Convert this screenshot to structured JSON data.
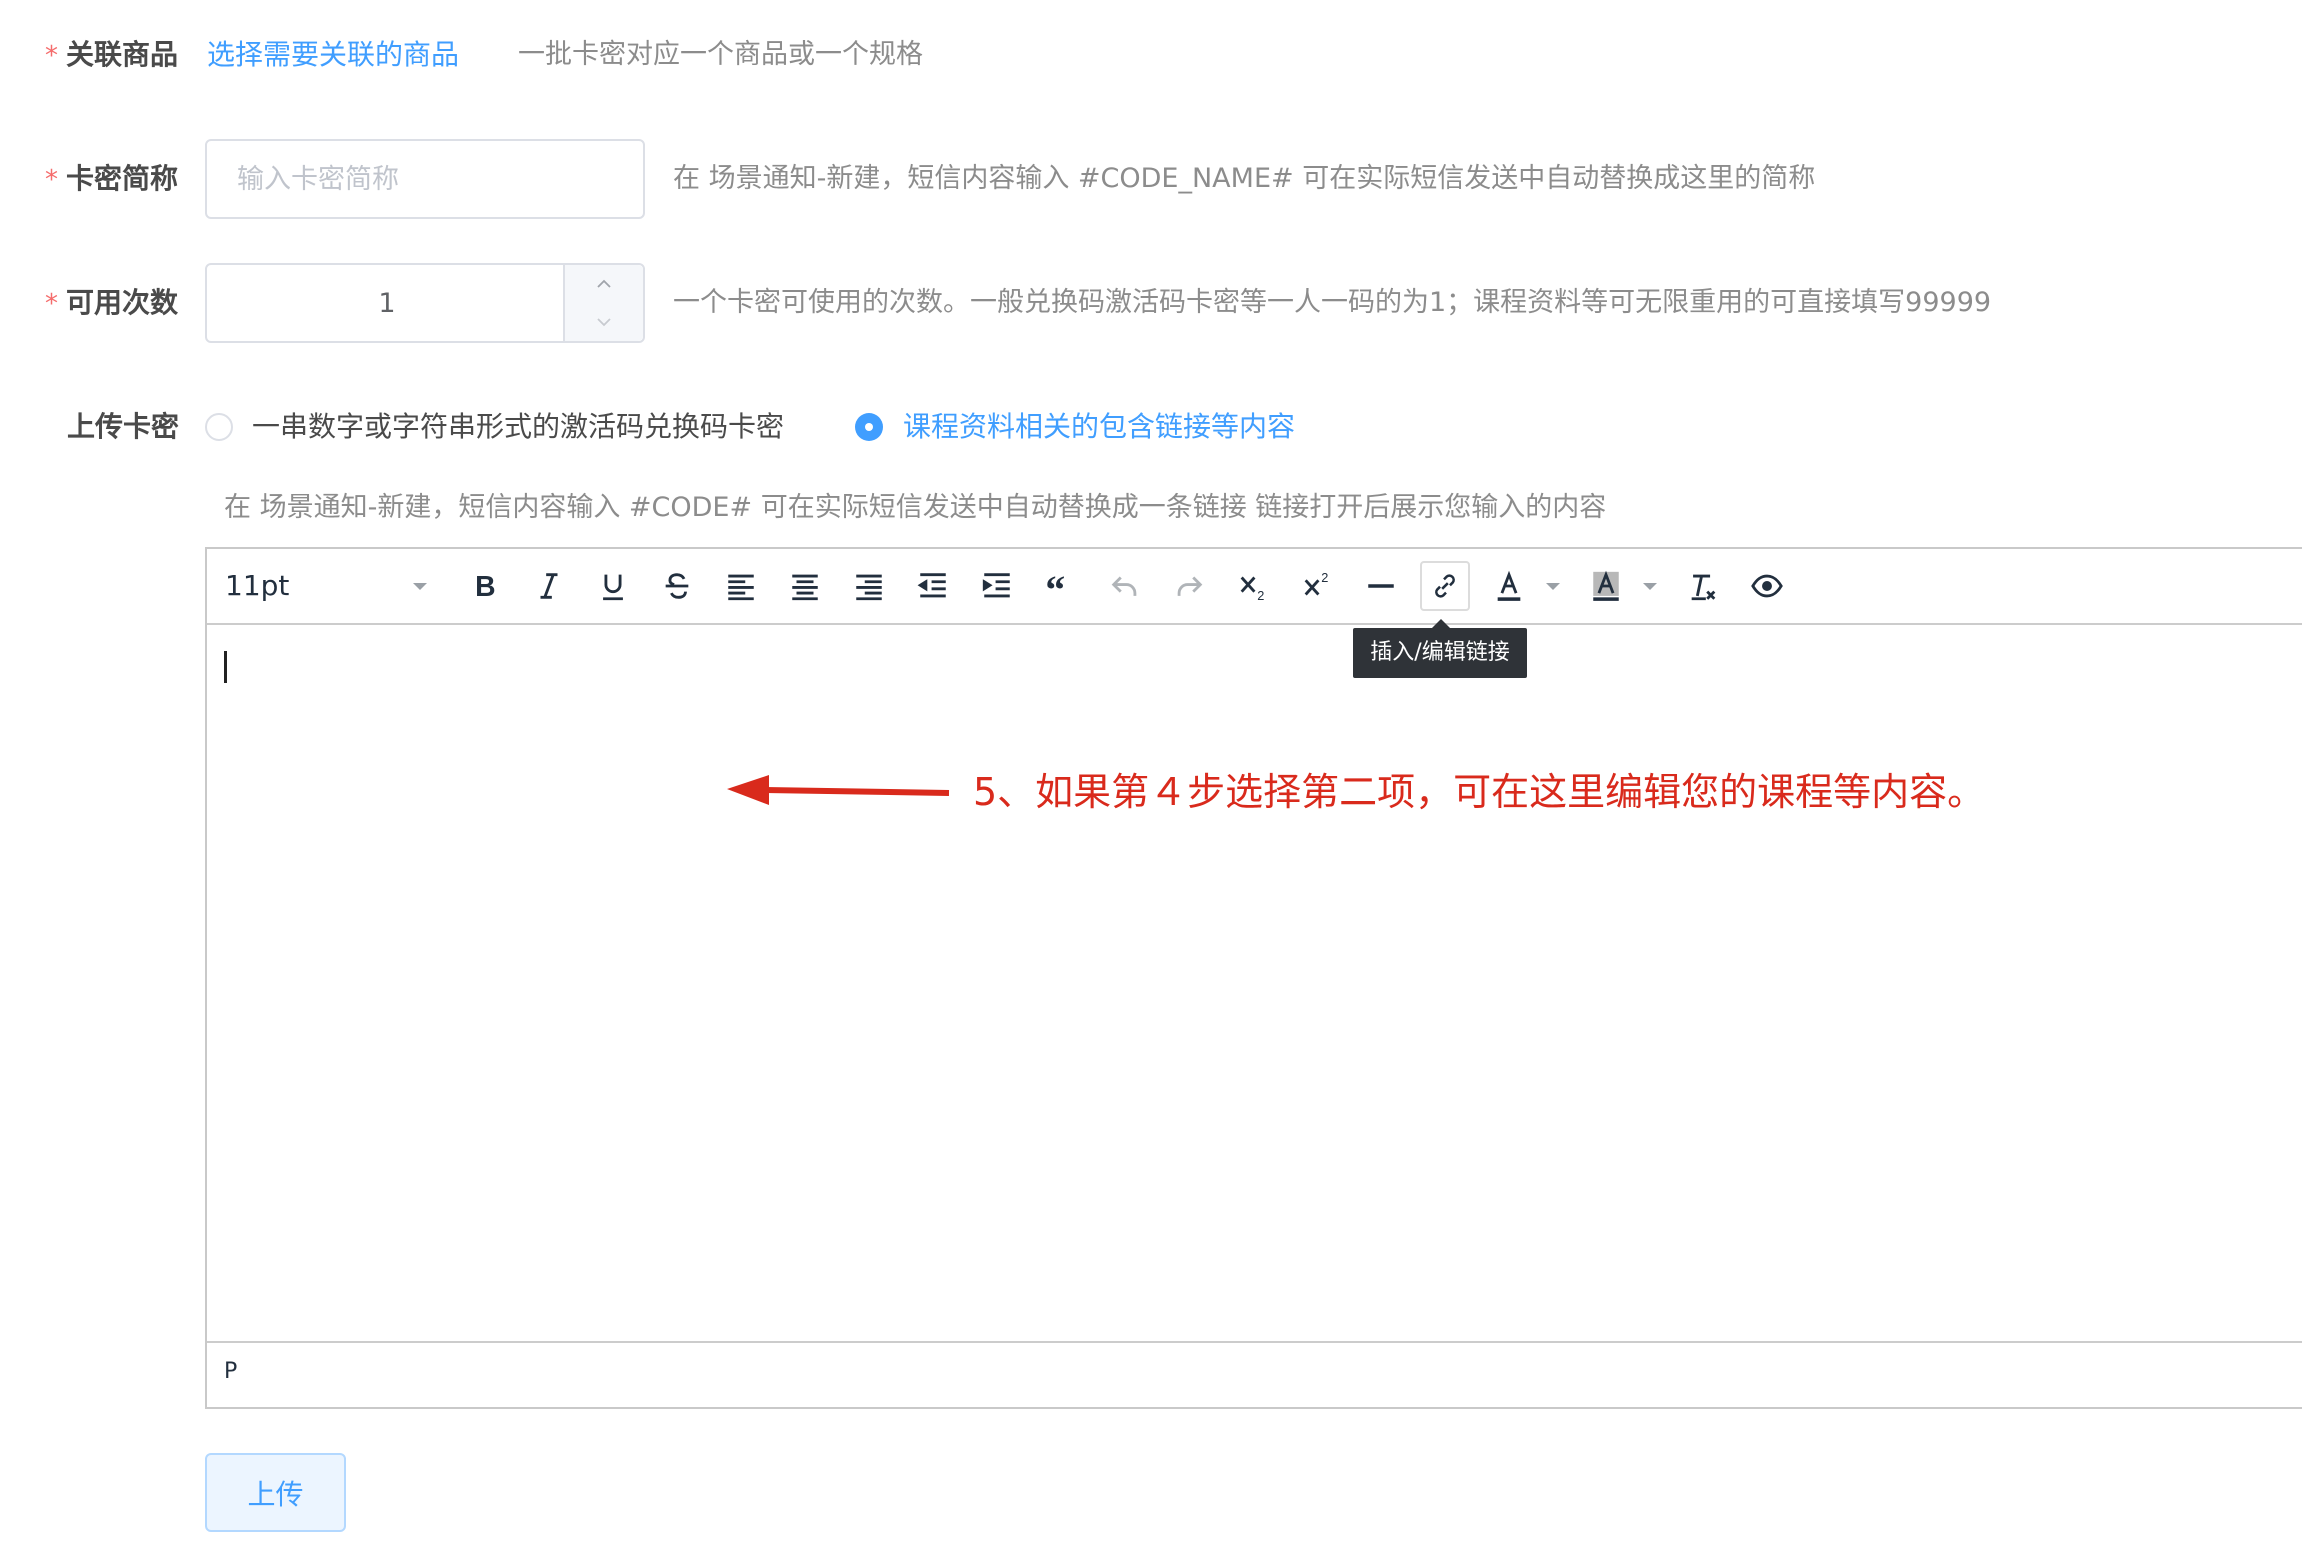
{
  "form": {
    "product": {
      "label": "关联商品",
      "select_link": "选择需要关联的商品",
      "hint": "一批卡密对应一个商品或一个规格"
    },
    "short_name": {
      "label": "卡密简称",
      "placeholder": "输入卡密简称",
      "hint": "在 场景通知-新建，短信内容输入 #CODE_NAME# 可在实际短信发送中自动替换成这里的简称"
    },
    "uses": {
      "label": "可用次数",
      "value": "1",
      "hint": "一个卡密可使用的次数。一般兑换码激活码卡密等一人一码的为1；课程资料等可无限重用的可直接填写99999"
    },
    "upload_type": {
      "label": "上传卡密",
      "options": [
        {
          "label": "一串数字或字符串形式的激活码兑换码卡密",
          "selected": false
        },
        {
          "label": "课程资料相关的包含链接等内容",
          "selected": true
        }
      ],
      "hint": "在 场景通知-新建，短信内容输入 #CODE# 可在实际短信发送中自动替换成一条链接 链接打开后展示您输入的内容"
    },
    "required_mark": "*",
    "submit_label": "上传"
  },
  "editor": {
    "font_size": "11pt",
    "tooltip": "插入/编辑链接",
    "status_path": "P",
    "toolbar_icons": [
      "bold-icon",
      "italic-icon",
      "underline-icon",
      "strikethrough-icon",
      "align-left-icon",
      "align-center-icon",
      "align-right-icon",
      "outdent-icon",
      "indent-icon",
      "blockquote-icon",
      "undo-icon",
      "redo-icon",
      "subscript-icon",
      "superscript-icon",
      "horizontal-rule-icon",
      "link-icon",
      "text-color-icon",
      "background-color-icon",
      "clear-format-icon",
      "preview-icon"
    ]
  },
  "annotation": {
    "text": "5、如果第４步选择第二项，可在这里编辑您的课程等内容。",
    "color": "#d92a1c"
  },
  "colors": {
    "accent": "#409eff",
    "required": "#f56c6c",
    "annotation": "#d92a1c"
  }
}
